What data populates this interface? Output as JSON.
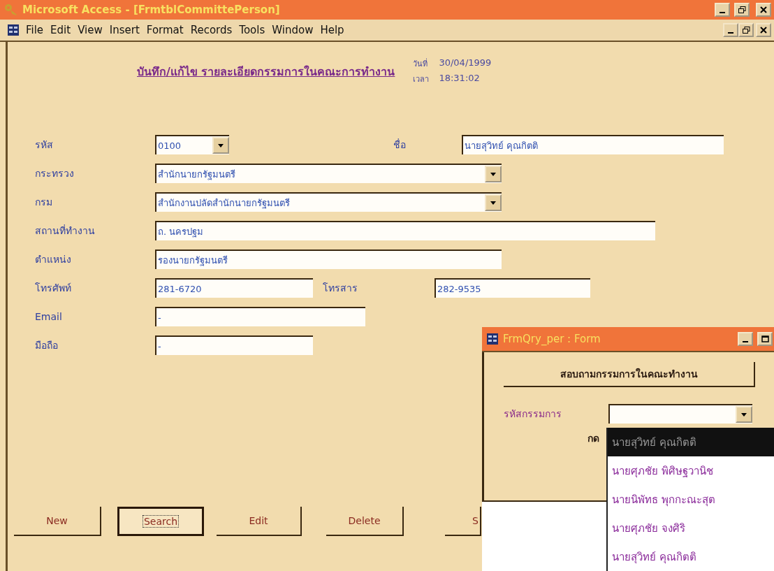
{
  "window": {
    "title": "Microsoft Access - [FrmtblCommittePerson]"
  },
  "menu": [
    "File",
    "Edit",
    "View",
    "Insert",
    "Format",
    "Records",
    "Tools",
    "Window",
    "Help"
  ],
  "form": {
    "heading": "บันทึก/แก้ไข รายละเอียดกรรมการในคณะการทำงาน",
    "date_label": "วันที่",
    "date": "30/04/1999",
    "time_label": "เวลา",
    "time": "18:31:02",
    "rows": [
      {
        "fields": [
          {
            "label": "รหัส",
            "value": "0100",
            "kind": "combo"
          },
          {
            "label": "ชื่อ",
            "value": "นายสุวิทย์ คุณกิตติ",
            "kind": "text"
          }
        ]
      },
      {
        "fields": [
          {
            "label": "กระทรวง",
            "value": "สำนักนายกรัฐมนตรี",
            "kind": "combo"
          }
        ]
      },
      {
        "fields": [
          {
            "label": "กรม",
            "value": "สำนักงานปลัดสำนักนายกรัฐมนตรี",
            "kind": "combo"
          }
        ]
      },
      {
        "fields": [
          {
            "label": "สถานที่ทำงาน",
            "value": "ถ. นครปฐม",
            "kind": "text"
          }
        ]
      },
      {
        "fields": [
          {
            "label": "ตำแหน่ง",
            "value": "รองนายกรัฐมนตรี",
            "kind": "text"
          }
        ]
      },
      {
        "fields": [
          {
            "label": "โทรศัพท์",
            "value": "281-6720",
            "kind": "text"
          },
          {
            "label": "โทรสาร",
            "value": "282-9535",
            "kind": "text"
          }
        ]
      },
      {
        "fields": [
          {
            "label": "Email",
            "value": "-",
            "kind": "text"
          }
        ]
      },
      {
        "fields": [
          {
            "label": "มือถือ",
            "value": "-",
            "kind": "text"
          }
        ]
      }
    ],
    "buttons": [
      {
        "label": "New",
        "focused": false
      },
      {
        "label": "Search",
        "focused": true
      },
      {
        "label": "Edit",
        "focused": false
      },
      {
        "label": "Delete",
        "focused": false
      },
      {
        "label": "S",
        "focused": false
      }
    ]
  },
  "popup": {
    "title": "FrmQry_per : Form",
    "button": "สอบถามกรรมการในคณะทำงาน",
    "field_label": "รหัสกรรมการ",
    "hint": "กด",
    "dropdown": [
      {
        "label": "นายสุวิทย์ คุณกิตติ",
        "selected": true
      },
      {
        "label": "นายศุภชัย พิศิษฐวานิช",
        "selected": false
      },
      {
        "label": "นายนิพัทธ พุกกะณะสุต",
        "selected": false
      },
      {
        "label": "นายศุภชัย จงศิริ",
        "selected": false
      },
      {
        "label": "นายสุวิทย์ คุณกิตติ",
        "selected": false
      }
    ]
  }
}
